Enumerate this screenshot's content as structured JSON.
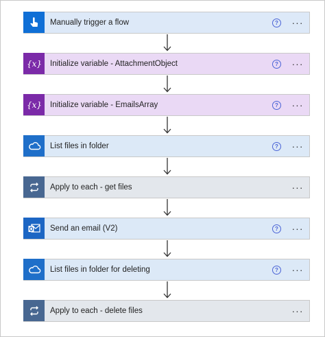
{
  "steps": [
    {
      "title": "Manually trigger a flow",
      "type": "trigger",
      "icon": "hand-touch-icon",
      "has_help": true,
      "help": "?",
      "more": "···"
    },
    {
      "title": "Initialize variable - AttachmentObject",
      "type": "variable",
      "icon": "variable-icon",
      "has_help": true,
      "help": "?",
      "more": "···"
    },
    {
      "title": "Initialize variable - EmailsArray",
      "type": "variable",
      "icon": "variable-icon",
      "has_help": true,
      "help": "?",
      "more": "···"
    },
    {
      "title": "List files in folder",
      "type": "onedrive",
      "icon": "cloud-icon",
      "has_help": true,
      "help": "?",
      "more": "···"
    },
    {
      "title": "Apply to each - get files",
      "type": "loop",
      "icon": "loop-icon",
      "has_help": false,
      "more": "···"
    },
    {
      "title": "Send an email (V2)",
      "type": "outlook",
      "icon": "outlook-icon",
      "has_help": true,
      "help": "?",
      "more": "···"
    },
    {
      "title": "List files in folder for deleting",
      "type": "onedrive",
      "icon": "cloud-icon",
      "has_help": true,
      "help": "?",
      "more": "···"
    },
    {
      "title": "Apply to each - delete files",
      "type": "loop",
      "icon": "loop-icon",
      "has_help": false,
      "more": "···"
    }
  ],
  "colors": {
    "trigger": {
      "icon_bg": "#0f6fd6",
      "card_bg": "#dde9f8"
    },
    "variable": {
      "icon_bg": "#7b2aa8",
      "card_bg": "#ead9f5"
    },
    "onedrive": {
      "icon_bg": "#1f6fc9",
      "card_bg": "#dce9f7"
    },
    "loop": {
      "icon_bg": "#486791",
      "card_bg": "#e3e7ec"
    },
    "outlook": {
      "icon_bg": "#1c66c4",
      "card_bg": "#dce9f7"
    }
  }
}
